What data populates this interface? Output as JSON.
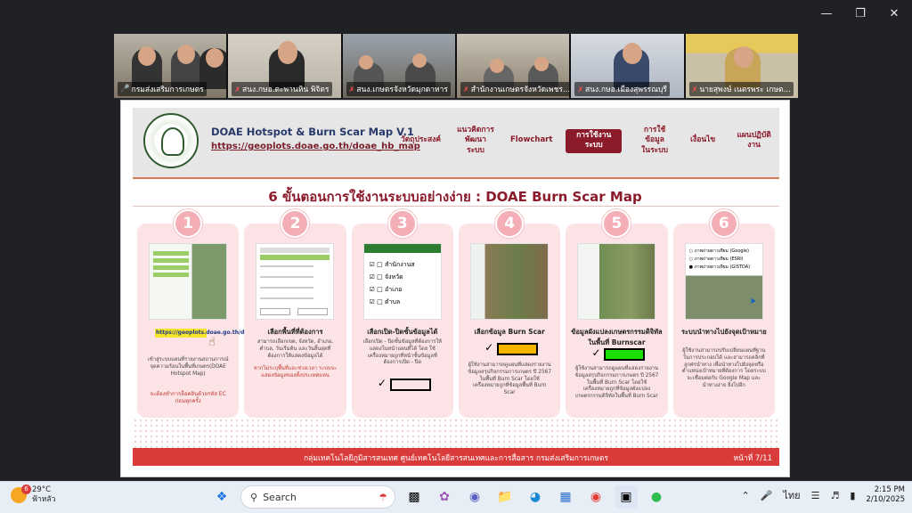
{
  "participants": [
    {
      "name": "กรมส่งเสริมการเกษตร",
      "muted": false
    },
    {
      "name": "สนง.กษอ.ตะพานหิน พิจิตร",
      "muted": true
    },
    {
      "name": "สนง.เกษตรจังหวัดมุกดาหาร",
      "muted": true
    },
    {
      "name": "สำนักงานเกษตรจังหวัดเพชร...",
      "muted": true
    },
    {
      "name": "สนง.กษอ.เมืองสุพรรณบุรี",
      "muted": true
    },
    {
      "name": "นายสุพงษ์ เนตรพระ เกษต...",
      "muted": true
    }
  ],
  "slide": {
    "app_title": "DOAE Hotspot & Burn Scar Map V.1",
    "app_url": "https://geoplots.doae.go.th/doae_hb_map",
    "nav": [
      {
        "label": "วัตถุประสงค์",
        "selected": false
      },
      {
        "label": "แนวคิดการ\nพัฒนาระบบ",
        "selected": false
      },
      {
        "label": "Flowchart",
        "selected": false
      },
      {
        "label": "การใช้งานระบบ",
        "selected": true
      },
      {
        "label": "การใช้ข้อมูล\nในระบบ",
        "selected": false
      },
      {
        "label": "เงื่อนไข",
        "selected": false
      },
      {
        "label": "แผนปฏิบัติงาน",
        "selected": false
      }
    ],
    "heading": "6 ขั้นตอนการใช้งานระบบอย่างง่าย : DOAE Burn Scar Map",
    "steps": [
      {
        "number": "1",
        "title": "",
        "url_chip": "https://geoplots.doae.go.th/doae_hb_map",
        "desc": "เข้าสู่ระบบแผนที่รายงานสถานการณ์จุดความร้อนในพื้นที่เกษตร(DOAE Hotspot Map)",
        "note": "จะต้องทำการล็อคอินด้วยรหัส EC ก่อนทุกครั้ง"
      },
      {
        "number": "2",
        "title": "เลือกพื้นที่ที่ต้องการ",
        "desc": "สามารถเลือกเขต, จังหวัด, อำเภอ, ตำบล, วันเริ่มต้น และวันสิ้นสุดที่ต้องการให้แสดงข้อมูลได้",
        "note": "หากไม่ระบุพื้นที่และช่วงเวลา ระบบจะแสดงข้อมูลของทั้งประเทศแทน"
      },
      {
        "number": "3",
        "title": "เลือกเปิด-ปิดชั้นข้อมูลได้",
        "desc": "เลือกเปิด - ปิดชั้นข้อมูลที่ต้องการให้แสดงในหน้าแผนที่ได้ โดย ใช้เครื่องหมายถูกที่หน้าชั้นข้อมูลที่ต้องการเปิด - ปิด",
        "layers": [
          "สำนักงานส",
          "จังหวัด",
          "อำเภอ",
          "ตำบล"
        ]
      },
      {
        "number": "4",
        "title": "เลือกข้อมูล Burn Scar",
        "desc": "ผู้ใช้งานสามารถดูแผนที่แสดงรายงานข้อมูลสรุปกิจกรรมการเกษตร ปี 2567 ในพื้นที่ Burn Scar โดยใช้เครื่องหมายถูกที่ข้อมูลพื้นที่ Burn Scar"
      },
      {
        "number": "5",
        "title": "ข้อมูลผังแปลงเกษตรกรรมดิจิทัลในพื้นที่ Burnscar",
        "desc": "ผู้ใช้งานสามารถดูแผนที่แสดงรายงานข้อมูลสรุปกิจกรรมการเกษตร ปี 2567 ในพื้นที่ Burn Scar โดยใช้เครื่องหมายถูกที่ข้อมูลผังแปลงเกษตรกรรมดิจิทัลในพื้นที่ Burn Scar"
      },
      {
        "number": "6",
        "title": "ระบบนำทางไปยังจุดเป้าหมาย",
        "desc": "ผู้ใช้งานสามารถปรับเปลี่ยนแผนที่ฐานในการประกอบได้ และสามารถคลิกที่ลูกศรนำทาง เพื่อนำทางไปยังจุดหรือตำแหน่งเป้าหมายที่ต้องการ โดยระบบจะเชื่อมต่อกับ Google Map และนำทางง่าย ยิ่งไปอีก",
        "basemaps": [
          "ภาพถ่ายดาวเทียม (Google)",
          "ภาพถ่ายดาวเทียม (ESRI)",
          "ภาพถ่ายดาวเทียม (GISTDA)"
        ]
      }
    ],
    "footer": "กลุ่มเทคโนโลยีภูมิสารสนเทศ ศูนย์เทคโนโลยีสารสนเทศและการสื่อสาร กรมส่งเสริมการเกษตร",
    "page": "หน้าที่ 7/11"
  },
  "taskbar": {
    "weather_temp": "29°C",
    "weather_desc": "ฟ้าหลัว",
    "weather_badge": "6",
    "search_placeholder": "Search",
    "language": "ไทย",
    "time": "2:15 PM",
    "date": "2/10/2025"
  },
  "colors": {
    "accent": "#8b1a2b",
    "card": "#fbe3e6",
    "badge": "#f4aeb6",
    "footer": "#d93b3b",
    "active_speaker": "#3dcf5a"
  }
}
